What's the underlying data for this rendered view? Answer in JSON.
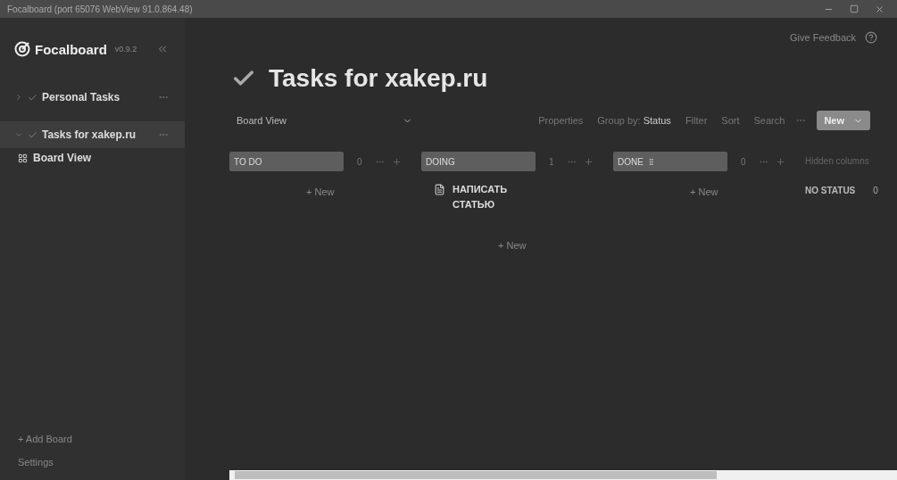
{
  "window": {
    "title": "Focalboard (port 65076 WebView 91.0.864.48)"
  },
  "sidebar": {
    "app_name": "Focalboard",
    "version": "v0.9.2",
    "boards": [
      {
        "title": "Personal Tasks",
        "expanded": false,
        "selected": false
      },
      {
        "title": "Tasks for xakep.ru",
        "expanded": true,
        "selected": true,
        "views": [
          {
            "title": "Board View"
          }
        ]
      }
    ],
    "add_board": "+ Add Board",
    "settings": "Settings"
  },
  "header": {
    "feedback": "Give Feedback"
  },
  "board": {
    "title": "Tasks for xakep.ru",
    "view": "Board View",
    "properties": "Properties",
    "group_by_label": "Group by:",
    "group_by_value": "Status",
    "filter": "Filter",
    "sort": "Sort",
    "search": "Search",
    "new_button": "New"
  },
  "columns": [
    {
      "title": "TO DO",
      "count": "0",
      "new": "+ New"
    },
    {
      "title": "DOING",
      "count": "1",
      "cards": [
        {
          "title": "НАПИСАТЬ СТАТЬЮ"
        }
      ],
      "new": "+ New"
    },
    {
      "title": "DONE",
      "count": "0",
      "new": "+ New"
    }
  ],
  "hidden_columns": {
    "label": "Hidden columns",
    "groups": [
      {
        "title": "NO STATUS",
        "count": "0"
      }
    ]
  }
}
